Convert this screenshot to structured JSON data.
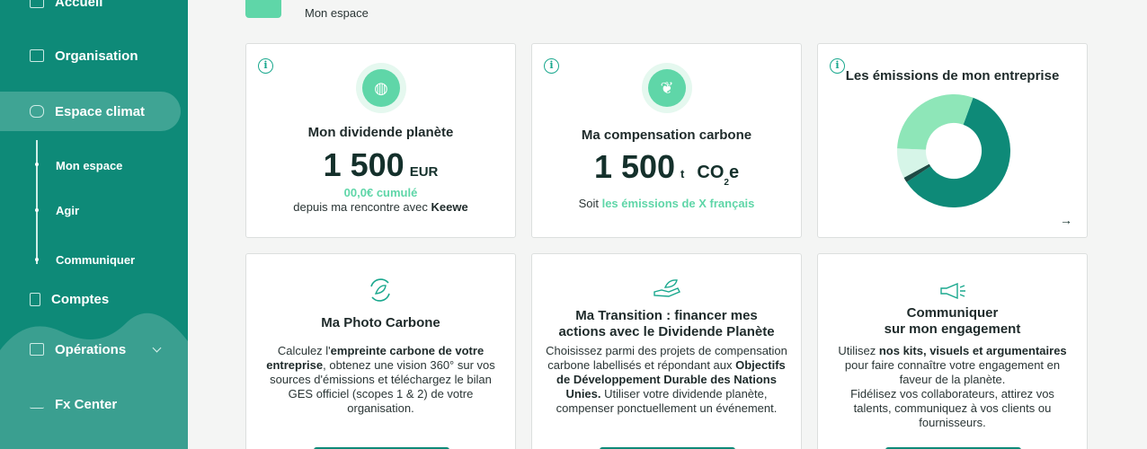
{
  "sidebar": {
    "items": [
      {
        "label": "Accueil",
        "icon": "home-icon"
      },
      {
        "label": "Organisation",
        "icon": "briefcase-icon"
      },
      {
        "label": "Espace climat",
        "icon": "cloud-sun-icon"
      },
      {
        "label": "Comptes",
        "icon": "document-icon"
      },
      {
        "label": "Opérations",
        "icon": "money-icon"
      },
      {
        "label": "Fx Center",
        "icon": "trend-chart-icon"
      }
    ],
    "subitems": [
      "Mon espace",
      "Agir",
      "Communiquer"
    ]
  },
  "header": {
    "subtitle": "Mon espace"
  },
  "cards": {
    "dividend": {
      "title": "Mon dividende planète",
      "value": "1 500",
      "unit": "EUR",
      "cumul": "00,0€ cumulé",
      "since_prefix": "depuis ma rencontre avec ",
      "since_brand": "Keewe"
    },
    "compensation": {
      "title": "Ma compensation carbone",
      "value": "1 500",
      "unit_t": "t",
      "unit_co": "CO",
      "unit_sub": "2",
      "unit_e": "e",
      "soit": "Soit ",
      "soit_link": "les émissions de X français"
    },
    "emissions": {
      "title": "Les émissions de mon entreprise",
      "arrow": "→"
    },
    "photo": {
      "title": "Ma Photo Carbone",
      "t1": "Calculez l'",
      "t1b": "empreinte carbone de votre entreprise",
      "t2": ", obtenez une vision 360° sur vos sources d'émissions et téléchargez le bilan GES officiel (scopes 1 & 2) de votre organisation."
    },
    "transition": {
      "title1": "Ma Transition : financer mes",
      "title2": "actions avec le Dividende Planète",
      "t1": "Choisissez parmi des projets de compensation carbone labellisés et répondant aux ",
      "t1b": "Objectifs de Développement Durable des Nations Unies.",
      "t2": " Utiliser votre dividende planète, compenser ponctuellement un événement."
    },
    "communiquer": {
      "title1": "Communiquer",
      "title2": "sur mon engagement",
      "t1": "Utilisez ",
      "t1b": "nos kits, visuels et argumentaires",
      "t2": " pour faire connaître votre engagement en faveur de la planète.",
      "t3": "Fidélisez vos collaborateurs, attirez vos talents, communiquez à vos clients ou fournisseurs."
    }
  },
  "donut": {
    "segments": [
      {
        "value": 0.6,
        "color": "#0e8a78"
      },
      {
        "value": 0.015,
        "color": "#1e4a44"
      },
      {
        "value": 0.085,
        "color": "#d6f5e8"
      },
      {
        "value": 0.3,
        "color": "#8ee6b8"
      }
    ]
  },
  "colors": {
    "accent": "#0e8a78",
    "mint": "#5fd6a8"
  }
}
